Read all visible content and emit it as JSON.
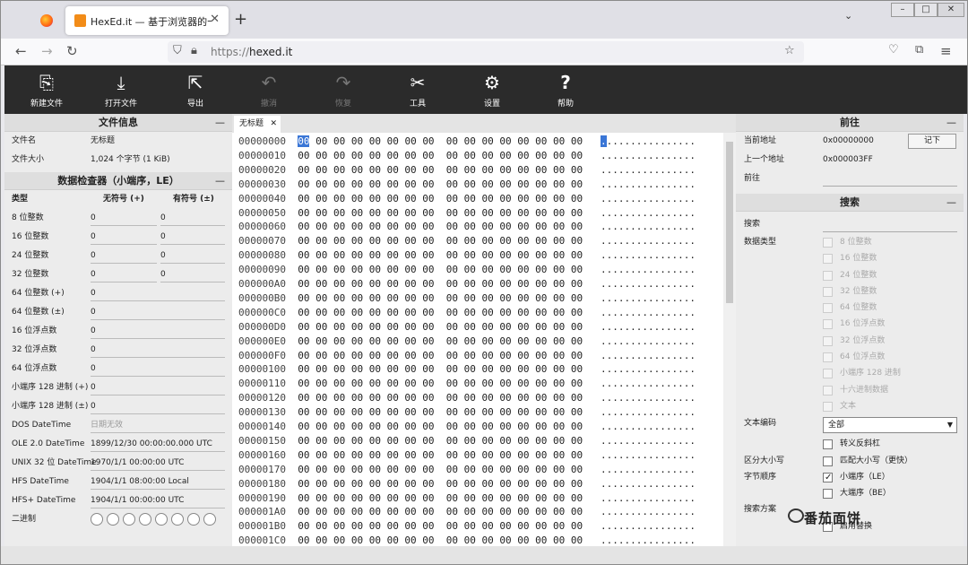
{
  "browser": {
    "tab_title": "HexEd.it — 基于浏览器的十六",
    "url_prefix": "https://",
    "url_host": "hexed.it"
  },
  "toolbar": [
    {
      "label": "新建文件",
      "icon": "new-file-icon",
      "enabled": true
    },
    {
      "label": "打开文件",
      "icon": "open-file-icon",
      "enabled": true
    },
    {
      "label": "导出",
      "icon": "export-icon",
      "enabled": true
    },
    {
      "label": "撤消",
      "icon": "undo-icon",
      "enabled": false
    },
    {
      "label": "恢复",
      "icon": "redo-icon",
      "enabled": false
    },
    {
      "label": "工具",
      "icon": "tools-icon",
      "enabled": true
    },
    {
      "label": "设置",
      "icon": "settings-gear-icon",
      "enabled": true
    },
    {
      "label": "帮助",
      "icon": "help-icon",
      "enabled": true
    }
  ],
  "file_info": {
    "title": "文件信息",
    "name_label": "文件名",
    "name_value": "无标题",
    "size_label": "文件大小",
    "size_value": "1,024 个字节 (1 KiB)"
  },
  "inspector": {
    "title": "数据检查器（小端序，LE）",
    "col_type": "类型",
    "col_unsigned": "无符号 (+)",
    "col_signed": "有符号 (±)",
    "rows": [
      {
        "k": "8 位整数",
        "u": "0",
        "s": "0"
      },
      {
        "k": "16 位整数",
        "u": "0",
        "s": "0"
      },
      {
        "k": "24 位整数",
        "u": "0",
        "s": "0"
      },
      {
        "k": "32 位整数",
        "u": "0",
        "s": "0"
      },
      {
        "k": "64 位整数 (+)",
        "v": "0"
      },
      {
        "k": "64 位整数 (±)",
        "v": "0"
      },
      {
        "k": "16 位浮点数",
        "v": "0"
      },
      {
        "k": "32 位浮点数",
        "v": "0"
      },
      {
        "k": "64 位浮点数",
        "v": "0"
      },
      {
        "k": "小端序 128 进制 (+)",
        "v": "0"
      },
      {
        "k": "小端序 128 进制 (±)",
        "v": "0"
      },
      {
        "k": "DOS DateTime",
        "v": "日期无效"
      },
      {
        "k": "OLE 2.0 DateTime",
        "v": "1899/12/30 00:00:00.000 UTC"
      },
      {
        "k": "UNIX 32 位 DateTime",
        "v": "1970/1/1 00:00:00 UTC"
      },
      {
        "k": "HFS DateTime",
        "v": "1904/1/1 08:00:00 Local"
      },
      {
        "k": "HFS+ DateTime",
        "v": "1904/1/1 00:00:00 UTC"
      },
      {
        "k": "二进制",
        "v": ""
      }
    ]
  },
  "editor": {
    "tab_label": "无标题",
    "first_byte": "00",
    "byte": "00",
    "ascii_first": ".",
    "ascii_rest": "...............",
    "rows": [
      "00000000",
      "00000010",
      "00000020",
      "00000030",
      "00000040",
      "00000050",
      "00000060",
      "00000070",
      "00000080",
      "00000090",
      "000000A0",
      "000000B0",
      "000000C0",
      "000000D0",
      "000000E0",
      "000000F0",
      "00000100",
      "00000110",
      "00000120",
      "00000130",
      "00000140",
      "00000150",
      "00000160",
      "00000170",
      "00000180",
      "00000190",
      "000001A0",
      "000001B0",
      "000001C0"
    ]
  },
  "goto": {
    "title": "前往",
    "current_label": "当前地址",
    "current_value": "0x00000000",
    "remember_button": "记下",
    "prev_label": "上一个地址",
    "prev_value": "0x000003FF",
    "goto_label": "前往"
  },
  "search": {
    "title": "搜索",
    "search_label": "搜索",
    "datatype_label": "数据类型",
    "datatypes": [
      "8 位整数",
      "16 位整数",
      "24 位整数",
      "32 位整数",
      "64 位整数",
      "16 位浮点数",
      "32 位浮点数",
      "64 位浮点数",
      "小端序 128 进制",
      "十六进制数据",
      "文本"
    ],
    "encoding_label": "文本编码",
    "encoding_value": "全部",
    "escape_label": "转义反斜杠",
    "case_label": "区分大小写",
    "case_option": "匹配大小写（更快）",
    "byteorder_label": "字节顺序",
    "little_endian": "小端序（LE）",
    "big_endian": "大端序（BE）",
    "scheme_label": "搜索方案",
    "scheme_option": "启用替换"
  },
  "watermark": "番茄面饼"
}
